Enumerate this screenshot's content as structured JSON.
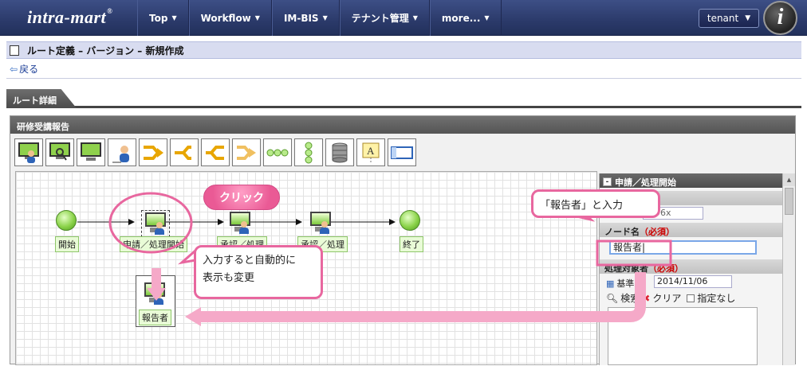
{
  "header": {
    "logo": "intra-mart",
    "logo_mark": "®",
    "menu": [
      {
        "label": "Top"
      },
      {
        "label": "Workflow"
      },
      {
        "label": "IM-BIS"
      },
      {
        "label": "テナント管理"
      },
      {
        "label": "more..."
      }
    ],
    "user_menu": "tenant",
    "badge": "i"
  },
  "page": {
    "title": "ルート定義 – バージョン – 新規作成",
    "back_label": "戻る",
    "tab": "ルート詳細"
  },
  "editor": {
    "route_name": "研修受講報告",
    "toolbar_icons": [
      "pc-user-icon",
      "pc-user-search-icon",
      "pc-icon",
      "user-icon",
      "branch-merge-icon",
      "split-arrow-icon",
      "merge-arrow-icon",
      "partial-branch-icon",
      "horizontal-flow-icon",
      "vertical-flow-icon",
      "database-icon",
      "text-annotation-icon",
      "frame-icon"
    ],
    "nodes": {
      "start": "開始",
      "apply": "申請／処理開始",
      "approve1": "承認／処理",
      "approve2": "承認／処理",
      "end": "終了",
      "renamed": "報告者"
    }
  },
  "properties": {
    "header": "申請／処理開始",
    "section_id": "（必須）",
    "id_value": "…96x",
    "section_node_name": "ノード名",
    "required_tag": "（必須）",
    "node_name_value": "報告者|",
    "section_target": "処理対象者",
    "base_date_label": "基準",
    "base_date_value": "2014/11/06",
    "search_label": "検索",
    "clear_label": "クリア",
    "none_label": "指定なし"
  },
  "annotations": {
    "click": "クリック",
    "input_hint": "「報告者」と入力",
    "auto_change_line1": "入力すると自動的に",
    "auto_change_line2": "表示も変更"
  },
  "colors": {
    "header_bg": "#2b3a6a",
    "accent_pink": "#e8679f",
    "node_green": "#8bd34a"
  }
}
